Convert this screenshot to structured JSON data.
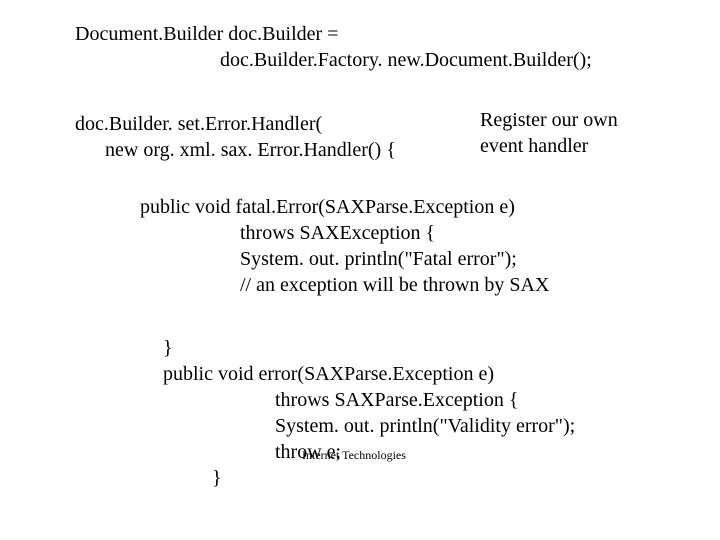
{
  "code": {
    "l1": "Document.Builder doc.Builder =",
    "l2": "doc.Builder.Factory. new.Document.Builder();",
    "l3": "doc.Builder. set.Error.Handler(",
    "l4": "new org. xml. sax. Error.Handler() {",
    "l5": "public void fatal.Error(SAXParse.Exception e)",
    "l6": "throws SAXException {",
    "l7": "System. out. println(\"Fatal error\");",
    "l8": "// an exception will be thrown by SAX",
    "l9": "}",
    "l10": "public void error(SAXParse.Exception e)",
    "l11": "throws SAXParse.Exception {",
    "l12": "System. out. println(\"Validity error\");",
    "l13": "throw e;",
    "l14": "}"
  },
  "annotation": {
    "line1": "Register our own",
    "line2": "event handler"
  },
  "footer": "Internet Technologies"
}
